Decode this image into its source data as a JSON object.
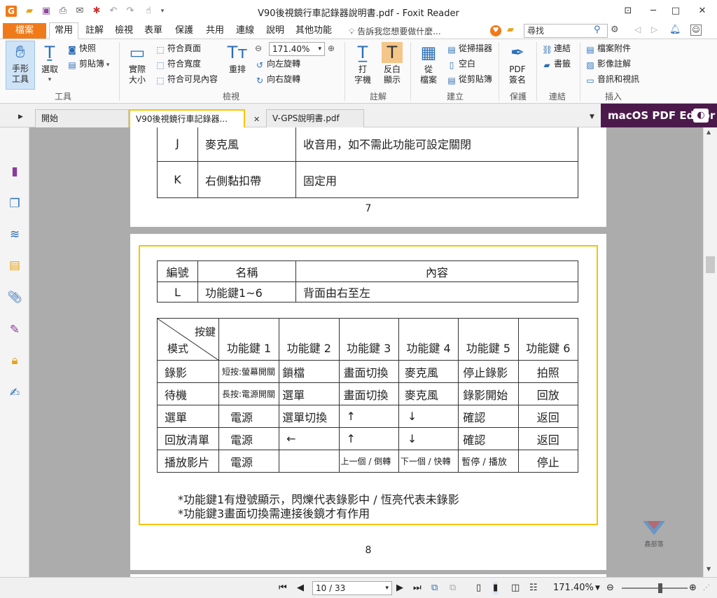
{
  "window": {
    "title": "V90後視鏡行車記錄器說明書.pdf - Foxit Reader",
    "min_symbol": "─",
    "max_symbol": "□",
    "close_symbol": "✕",
    "restore_symbol": "⧉"
  },
  "menu": {
    "file_label": "檔案",
    "items": [
      "常用",
      "註解",
      "檢視",
      "表單",
      "保護",
      "共用",
      "連線",
      "說明",
      "其他功能"
    ],
    "tell_me": "告訴我您想要做什麼...",
    "search_placeholder": "尋找"
  },
  "ribbon": {
    "tools": {
      "hand_label1": "手形",
      "hand_label2": "工具",
      "select_label": "選取",
      "snapshot_label": "快照",
      "clipboard_label": "剪貼簿",
      "group": "工具"
    },
    "view": {
      "actual1": "實際",
      "actual2": "大小",
      "fit_page": "符合頁面",
      "fit_width": "符合寬度",
      "fit_visible": "符合可見內容",
      "reflow": "重排",
      "zoom_value": "171.40%",
      "rotate_left": "向左旋轉",
      "rotate_right": "向右旋轉",
      "group": "檢視"
    },
    "comment": {
      "typewriter1": "打",
      "typewriter2": "字機",
      "highlight1": "反白",
      "highlight2": "顯示",
      "group": "註解"
    },
    "create": {
      "from_file1": "從",
      "from_file2": "檔案",
      "from_scanner": "從掃描器",
      "blank": "空白",
      "from_clipboard": "從剪貼簿",
      "group": "建立"
    },
    "protect": {
      "sign1": "PDF",
      "sign2": "簽名",
      "group": "保護"
    },
    "links": {
      "link": "連結",
      "bookmark": "書籤",
      "group": "連結"
    },
    "insert": {
      "attachment": "檔案附件",
      "image_annot": "影像註解",
      "audio_video": "音訊和視訊",
      "group": "插入"
    }
  },
  "tabs": [
    {
      "label": "開始"
    },
    {
      "label": "V90後視鏡行車記錄器..."
    },
    {
      "label": "V-GPS說明書.pdf"
    }
  ],
  "brand": "macOS PDF Editor",
  "page7": {
    "rows": [
      {
        "id": "J",
        "name": "麥克風",
        "desc": "收音用，如不需此功能可設定關閉"
      },
      {
        "id": "K",
        "name": "右側黏扣帶",
        "desc": "固定用"
      }
    ],
    "page_number": "7"
  },
  "page8": {
    "header": {
      "id": "編號",
      "name": "名稱",
      "desc": "內容"
    },
    "row": {
      "id": "L",
      "name": "功能鍵1~6",
      "desc": "背面由右至左"
    },
    "corner_top": "按鍵",
    "corner_bottom": "模式",
    "keys": [
      "功能鍵 1",
      "功能鍵 2",
      "功能鍵 3",
      "功能鍵 4",
      "功能鍵 5",
      "功能鍵 6"
    ],
    "modes": [
      {
        "mode": "錄影",
        "k1": "短按:螢幕開關",
        "k2": "鎖檔",
        "k3": "畫面切換",
        "k4": "麥克風",
        "k5": "停止錄影",
        "k6": "拍照"
      },
      {
        "mode": "待機",
        "k1": "長按:電源開關",
        "k2": "選單",
        "k3": "畫面切換",
        "k4": "麥克風",
        "k5": "錄影開始",
        "k6": "回放"
      },
      {
        "mode": "選單",
        "k1": "電源",
        "k2": "選單切換",
        "k3": "↑",
        "k4": "↓",
        "k5": "確認",
        "k6": "返回"
      },
      {
        "mode": "回放清單",
        "k1": "電源",
        "k2": "←",
        "k3": "↑",
        "k4": "↓",
        "k5": "確認",
        "k6": "返回"
      },
      {
        "mode": "播放影片",
        "k1": "電源",
        "k2": "",
        "k3": "上一個 / 倒轉",
        "k4": "下一個 / 快轉",
        "k5": "暫停 / 播放",
        "k6": "停止"
      }
    ],
    "note1": "*功能鍵1有燈號顯示，閃爍代表錄影中 / 恆亮代表未錄影",
    "note2": "*功能鍵3畫面切換需連接後鏡才有作用",
    "watermark": "鑫部落",
    "page_number": "8"
  },
  "status": {
    "page_field": "10 / 33",
    "zoom": "171.40%"
  }
}
